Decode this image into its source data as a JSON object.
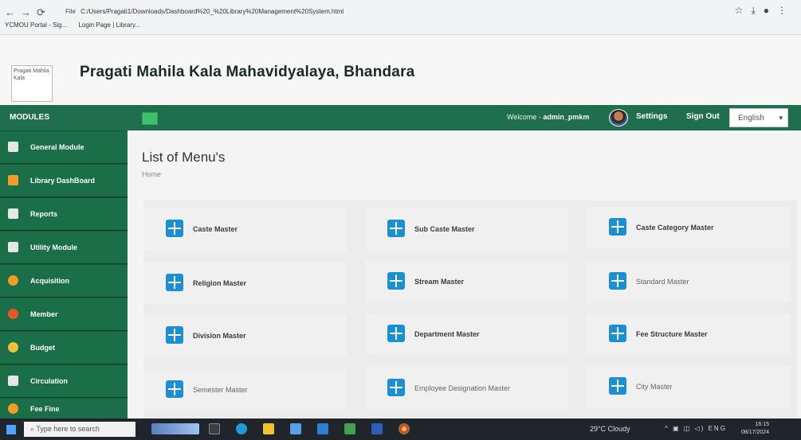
{
  "browser": {
    "address": "C:/Users/Pragati1/Downloads/Dashboard%20_%20Library%20Management%20System.html",
    "file_chip": "File",
    "bookmarks": [
      "YCMOU Portal - Sig...",
      "Login Page | Library..."
    ]
  },
  "header": {
    "logo_alt": "Pragati Mahila Kala",
    "college_name": "Pragati Mahila Kala Mahavidyalaya, Bhandara"
  },
  "topbar": {
    "modules_label": "MODULES",
    "welcome_prefix": "Welcome -",
    "username": "admin_pmkm",
    "settings_label": "Settings",
    "signout_label": "Sign Out",
    "language": "English"
  },
  "sidebar": {
    "items": [
      {
        "label": "General Module"
      },
      {
        "label": "Library DashBoard"
      },
      {
        "label": "Reports"
      },
      {
        "label": "Utility Module"
      },
      {
        "label": "Acquisition"
      },
      {
        "label": "Member"
      },
      {
        "label": "Budget"
      },
      {
        "label": "Circulation"
      },
      {
        "label": "Fee Fine"
      }
    ]
  },
  "main": {
    "title": "List of Menu's",
    "breadcrumb": "Home",
    "tiles": [
      {
        "label": "Caste Master"
      },
      {
        "label": "Sub Caste Master"
      },
      {
        "label": "Caste Category Master"
      },
      {
        "label": "Religion Master"
      },
      {
        "label": "Stream Master"
      },
      {
        "label": "Standard Master"
      },
      {
        "label": "Division Master"
      },
      {
        "label": "Department Master"
      },
      {
        "label": "Fee Structure Master"
      },
      {
        "label": "Semester Master"
      },
      {
        "label": "Employee Designation Master"
      },
      {
        "label": "City Master"
      }
    ]
  },
  "taskbar": {
    "search_placeholder": "Type here to search",
    "weather": "29°C Cloudy",
    "tray": "ENG",
    "time": "16:15",
    "date": "08/17/2024"
  },
  "colors": {
    "primary_green": "#1f6f4e",
    "sidebar_item": "#1a6e48",
    "tile_icon": "#1a8fd1"
  }
}
